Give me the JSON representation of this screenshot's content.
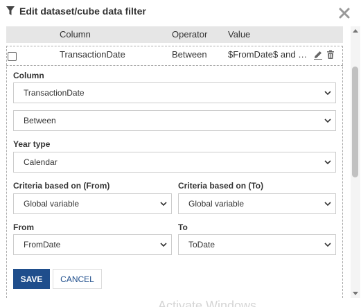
{
  "dialog": {
    "title": "Edit dataset/cube data filter"
  },
  "grid": {
    "headers": {
      "column": "Column",
      "operator": "Operator",
      "value": "Value"
    },
    "row": {
      "column": "TransactionDate",
      "operator": "Between",
      "value": "$FromDate$ and $ToDate$"
    }
  },
  "form": {
    "column_label": "Column",
    "column_value": "TransactionDate",
    "operator_value": "Between",
    "year_type_label": "Year type",
    "year_type_value": "Calendar",
    "criteria_from_label": "Criteria based on (From)",
    "criteria_from_value": "Global variable",
    "criteria_to_label": "Criteria based on (To)",
    "criteria_to_value": "Global variable",
    "from_label": "From",
    "from_value": "FromDate",
    "to_label": "To",
    "to_value": "ToDate"
  },
  "buttons": {
    "save": "SAVE",
    "cancel": "CANCEL"
  },
  "watermark": "Activate Windows",
  "colors": {
    "primary": "#1f4e8c",
    "header_bg": "#e6e6e6",
    "border": "#cccccc"
  }
}
